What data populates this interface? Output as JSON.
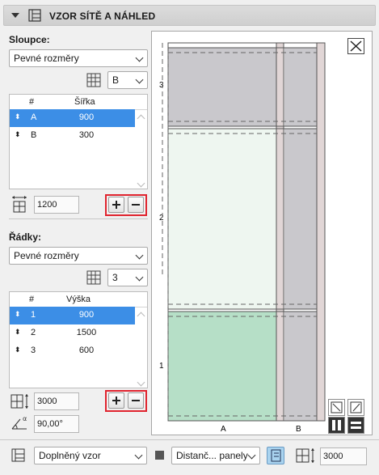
{
  "header": {
    "title": "VZOR SÍTĚ A NÁHLED"
  },
  "columns": {
    "label": "Sloupce:",
    "mode": "Pevné rozměry",
    "selected_key": "B",
    "table_headers": [
      "#",
      "Šířka"
    ],
    "rows": [
      {
        "key": "A",
        "value": "900",
        "selected": true
      },
      {
        "key": "B",
        "value": "300",
        "selected": false
      }
    ],
    "total": "1200"
  },
  "rows_section": {
    "label": "Řádky:",
    "mode": "Pevné rozměry",
    "selected_key": "3",
    "table_headers": [
      "#",
      "Výška"
    ],
    "rows": [
      {
        "key": "1",
        "value": "900",
        "selected": true
      },
      {
        "key": "2",
        "value": "1500",
        "selected": false
      },
      {
        "key": "3",
        "value": "600",
        "selected": false
      }
    ],
    "total": "3000",
    "angle": "90,00°"
  },
  "preview": {
    "row_labels": [
      "3",
      "2",
      "1"
    ],
    "col_labels": [
      "A",
      "B"
    ],
    "colors": {
      "glass_green": "#b6dfc7",
      "light_green": "#eef6f0",
      "gray_panel": "#c9c8cc",
      "frame": "#e1d6d6"
    }
  },
  "bottom": {
    "pattern": "Doplněný vzor",
    "panel": "Distanč... panely",
    "height": "3000"
  },
  "icons": {
    "close": "close-icon",
    "add": "plus-icon",
    "remove": "minus-icon"
  }
}
